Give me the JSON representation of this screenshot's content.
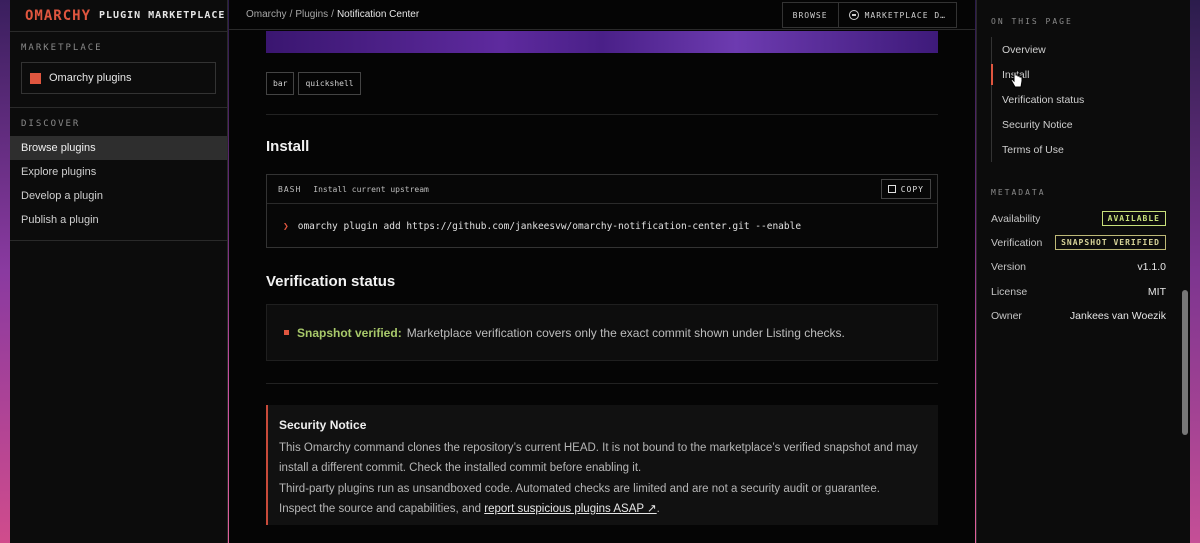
{
  "brand": {
    "logo": "OMARCHY",
    "title": "PLUGIN MARKETPLACE"
  },
  "sidebar": {
    "marketplace_label": "MARKETPLACE",
    "marketplace_item": "Omarchy plugins",
    "discover_label": "DISCOVER",
    "items": [
      {
        "label": "Browse plugins",
        "active": true
      },
      {
        "label": "Explore plugins",
        "active": false
      },
      {
        "label": "Develop a plugin",
        "active": false
      },
      {
        "label": "Publish a plugin",
        "active": false
      }
    ]
  },
  "topbar": {
    "breadcrumb": [
      "Omarchy",
      "Plugins",
      "Notification Center"
    ],
    "separator": "/",
    "browse_label": "BROWSE",
    "marketplace_label": "MARKETPLACE D…"
  },
  "tags": [
    "bar",
    "quickshell"
  ],
  "install": {
    "heading": "Install",
    "lang": "BASH",
    "caption": "Install current upstream",
    "copy_label": "COPY",
    "prompt": "❯",
    "command": "omarchy plugin add https://github.com/jankeesvw/omarchy-notification-center.git --enable"
  },
  "verification": {
    "heading": "Verification status",
    "strong": "Snapshot verified:",
    "text": "Marketplace verification covers only the exact commit shown under Listing checks."
  },
  "notice": {
    "title": "Security Notice",
    "p1": "This Omarchy command clones the repository’s current HEAD. It is not bound to the marketplace’s verified snapshot and may install a different commit. Check the installed commit before enabling it.",
    "p2": "Third-party plugins run as unsandboxed code. Automated checks are limited and are not a security audit or guarantee. Inspect the source and capabilities, and",
    "link": "report suspicious plugins ASAP ↗",
    "p2_end": "."
  },
  "rail": {
    "toc_label": "ON THIS PAGE",
    "toc": [
      "Overview",
      "Install",
      "Verification status",
      "Security Notice",
      "Terms of Use"
    ],
    "toc_active": "Install",
    "meta_label": "METADATA",
    "meta": {
      "availability_key": "Availability",
      "availability_val": "AVAILABLE",
      "verification_key": "Verification",
      "verification_val": "SNAPSHOT VERIFIED",
      "version_key": "Version",
      "version_val": "v1.1.0",
      "license_key": "License",
      "license_val": "MIT",
      "owner_key": "Owner",
      "owner_val": "Jankees van Woezik"
    }
  },
  "colors": {
    "accent": "#e0563f",
    "verified": "#a8c96a",
    "background": "#050505"
  }
}
